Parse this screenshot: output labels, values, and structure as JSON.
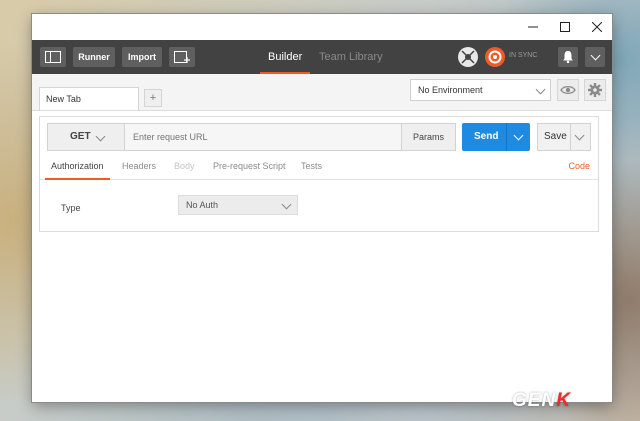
{
  "window": {
    "controls": [
      "minimize-icon",
      "maximize-icon",
      "close-icon"
    ]
  },
  "toolbar": {
    "sidebar_toggle_icon": "sidebar-toggle-icon",
    "runner_label": "Runner",
    "import_label": "Import",
    "new_window_icon": "new-window-icon",
    "builder_label": "Builder",
    "team_library_label": "Team Library",
    "sync_status": "IN SYNC",
    "interceptor_icon": "satellite-icon",
    "notifications_icon": "bell-icon",
    "menu_icon": "chevron-down-icon"
  },
  "tabs": {
    "current_tab_label": "New Tab",
    "add_tab_label": "+"
  },
  "environment": {
    "selected": "No Environment",
    "quick_look_icon": "eye-icon",
    "settings_icon": "gear-icon"
  },
  "request": {
    "method": "GET",
    "url_placeholder": "Enter request URL",
    "params_label": "Params",
    "send_label": "Send",
    "save_label": "Save"
  },
  "subtabs": {
    "items": [
      "Authorization",
      "Headers",
      "Body",
      "Pre-request Script",
      "Tests"
    ],
    "active": "Authorization",
    "code_label": "Code"
  },
  "authorization": {
    "type_label": "Type",
    "type_value": "No Auth"
  },
  "watermark": {
    "text_main": "GEN",
    "text_accent": "K"
  },
  "colors": {
    "accent": "#ef5b25",
    "send_blue": "#1f8be0",
    "toolbar_bg": "#424242"
  }
}
